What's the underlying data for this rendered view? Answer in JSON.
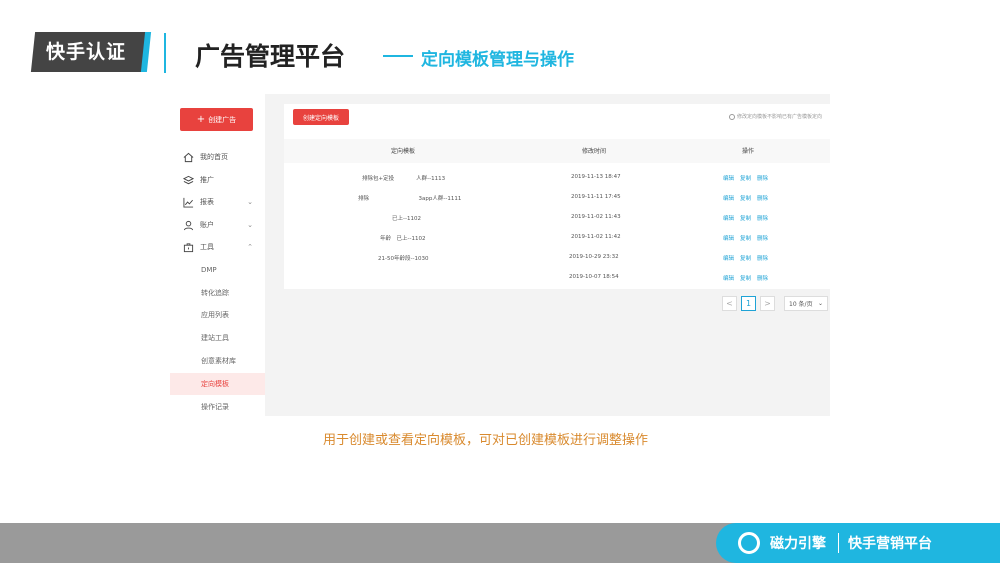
{
  "header": {
    "badge": "快手认证",
    "title": "广告管理平台",
    "subtitle": "定向模板管理与操作"
  },
  "app": {
    "create_ad_button": "创建广告",
    "create_template_button": "创建定向模板",
    "hint": "修改定向模板不影响已有广告模板定向",
    "sidebar": {
      "items": [
        {
          "label": "我的首页",
          "icon": "home-icon"
        },
        {
          "label": "推广",
          "icon": "layers-icon"
        },
        {
          "label": "报表",
          "icon": "chart-icon"
        },
        {
          "label": "账户",
          "icon": "user-icon"
        },
        {
          "label": "工具",
          "icon": "toolbox-icon"
        }
      ],
      "subitems": [
        {
          "label": "DMP"
        },
        {
          "label": "转化追踪"
        },
        {
          "label": "应用列表"
        },
        {
          "label": "建站工具"
        },
        {
          "label": "创意素材库"
        },
        {
          "label": "定向模板"
        },
        {
          "label": "操作记录"
        }
      ]
    },
    "table": {
      "columns": [
        "定向模板",
        "修改时间",
        "操作"
      ],
      "rows": [
        {
          "name": "排除包+定投　　　　人群--1113",
          "time": "2019-11-13 18:47"
        },
        {
          "name": "排除　　　　　　　　　3app人群--1111",
          "time": "2019-11-11 17:45"
        },
        {
          "name": "已上--1102",
          "time": "2019-11-02 11:43"
        },
        {
          "name": "年龄　已上--1102",
          "time": "2019-11-02 11:42"
        },
        {
          "name": "21-50年龄段--1030",
          "time": "2019-10-29 23:32"
        },
        {
          "name": "",
          "time": "2019-10-07 18:54"
        }
      ],
      "actions": [
        "编辑",
        "复制",
        "删除"
      ]
    },
    "pager": {
      "prev": "<",
      "current": "1",
      "next": ">",
      "page_size": "10 条/页"
    }
  },
  "caption": "用于创建或查看定向模板，可对已创建模板进行调整操作",
  "footer": {
    "brand": "磁力引擎",
    "platform": "快手营销平台"
  },
  "colors": {
    "accent": "#1fb6e0",
    "primary_red": "#e8423e",
    "caption": "#d98a2e"
  }
}
